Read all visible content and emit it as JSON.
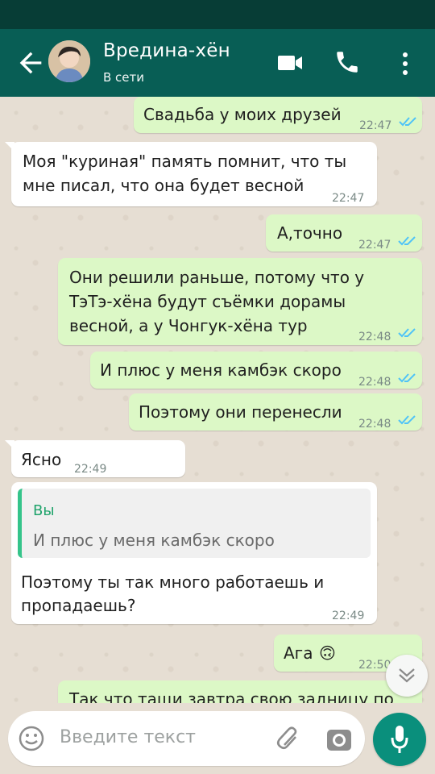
{
  "header": {
    "contact_name": "Вредина-хён",
    "status": "В сети"
  },
  "messages": [
    {
      "type": "out",
      "text": "Свадьба у моих друзей",
      "time": "22:47"
    },
    {
      "type": "in",
      "text_lines": [
        "Моя \"куриная\" память помнит, что ты",
        "мне писал, что она будет весной"
      ],
      "time": "22:47"
    },
    {
      "type": "out",
      "text": "А,точно",
      "time": "22:47"
    },
    {
      "type": "out",
      "text_lines": [
        "Они решили раньше, потому что у",
        "ТэТэ-хёна будут съёмки дорамы",
        "весной, а у Чонгук-хёна тур"
      ],
      "time": "22:48"
    },
    {
      "type": "out",
      "text": "И плюс у меня камбэк скоро",
      "time": "22:48"
    },
    {
      "type": "out",
      "text": "Поэтому они перенесли",
      "time": "22:48"
    },
    {
      "type": "in",
      "text": "Ясно",
      "time": "22:49"
    },
    {
      "type": "in",
      "quote": {
        "author": "Вы",
        "text": "И плюс у меня камбэк скоро"
      },
      "text_lines": [
        "Поэтому ты так много работаешь и",
        "пропадаешь?"
      ],
      "time": "22:49"
    },
    {
      "type": "out",
      "text": "Ага",
      "emoji": "🙃",
      "time": "22:50"
    },
    {
      "type": "out",
      "text": "Так что тащи завтра свою задницу по"
    }
  ],
  "composer": {
    "placeholder": "Введите текст"
  },
  "icons": {
    "back": "arrow-left-icon",
    "video": "video-call-icon",
    "call": "phone-icon",
    "menu": "more-vertical-icon",
    "emoji": "emoji-icon",
    "attach": "paperclip-icon",
    "camera": "camera-icon",
    "mic": "microphone-icon",
    "scroll": "double-chevron-down-icon"
  },
  "colors": {
    "header": "#085e55",
    "status_bar": "#073d36",
    "outgoing_bubble": "#dcf8c6",
    "incoming_bubble": "#ffffff",
    "read_tick": "#4fc3f7",
    "accent": "#0a8f7c"
  }
}
